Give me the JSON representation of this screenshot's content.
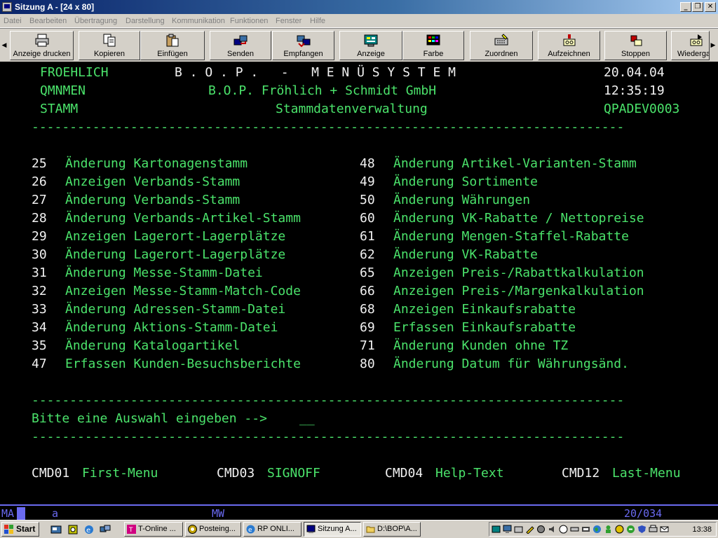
{
  "window": {
    "title": "Sitzung A - [24 x 80]"
  },
  "menubar": {
    "items": [
      "Datei",
      "Bearbeiten",
      "Übertragung",
      "Darstellung",
      "Kommunikation",
      "Funktionen",
      "Fenster",
      "Hilfe"
    ]
  },
  "toolbar": {
    "buttons": [
      {
        "label": "Anzeige drucken",
        "icon": "printer-icon"
      },
      {
        "label": "Kopieren",
        "icon": "copy-icon"
      },
      {
        "label": "Einfügen",
        "icon": "paste-icon"
      },
      {
        "label": "Senden",
        "icon": "send-icon"
      },
      {
        "label": "Empfangen",
        "icon": "receive-icon"
      },
      {
        "label": "Anzeige",
        "icon": "display-icon"
      },
      {
        "label": "Farbe",
        "icon": "color-icon"
      },
      {
        "label": "Zuordnen",
        "icon": "keyboard-icon"
      },
      {
        "label": "Aufzeichnen",
        "icon": "record-icon"
      },
      {
        "label": "Stoppen",
        "icon": "stop-icon"
      },
      {
        "label": "Wiedergabe",
        "icon": "play-icon"
      }
    ]
  },
  "terminal": {
    "header": {
      "user": "FROEHLICH",
      "system_title": "B . O . P .   -   M E N Ü S Y S T E M",
      "date": "20.04.04",
      "program": "QMNMEN",
      "company": "B.O.P. Fröhlich + Schmidt GmbH",
      "time": "12:35:19",
      "menu": "STAMM",
      "menu_title": "Stammdatenverwaltung",
      "device": "QPADEV0003"
    },
    "separator": "------------------------------------------------------------------------------",
    "options_left": [
      {
        "num": "25",
        "text": "Änderung Kartonagenstamm"
      },
      {
        "num": "26",
        "text": "Anzeigen Verbands-Stamm"
      },
      {
        "num": "27",
        "text": "Änderung Verbands-Stamm"
      },
      {
        "num": "28",
        "text": "Änderung Verbands-Artikel-Stamm"
      },
      {
        "num": "29",
        "text": "Anzeigen Lagerort-Lagerplätze"
      },
      {
        "num": "30",
        "text": "Änderung Lagerort-Lagerplätze"
      },
      {
        "num": "31",
        "text": "Änderung Messe-Stamm-Datei"
      },
      {
        "num": "32",
        "text": "Anzeigen Messe-Stamm-Match-Code"
      },
      {
        "num": "33",
        "text": "Änderung Adressen-Stamm-Datei"
      },
      {
        "num": "34",
        "text": "Änderung Aktions-Stamm-Datei"
      },
      {
        "num": "35",
        "text": "Änderung Katalogartikel"
      },
      {
        "num": "47",
        "text": "Erfassen Kunden-Besuchsberichte"
      }
    ],
    "options_right": [
      {
        "num": "48",
        "text": "Änderung Artikel-Varianten-Stamm"
      },
      {
        "num": "49",
        "text": "Änderung Sortimente"
      },
      {
        "num": "50",
        "text": "Änderung Währungen"
      },
      {
        "num": "60",
        "text": "Änderung VK-Rabatte / Nettopreise"
      },
      {
        "num": "61",
        "text": "Änderung Mengen-Staffel-Rabatte"
      },
      {
        "num": "62",
        "text": "Änderung VK-Rabatte"
      },
      {
        "num": "65",
        "text": "Anzeigen Preis-/Rabattkalkulation"
      },
      {
        "num": "66",
        "text": "Anzeigen Preis-/Margenkalkulation"
      },
      {
        "num": "68",
        "text": "Anzeigen Einkaufsrabatte"
      },
      {
        "num": "69",
        "text": "Erfassen Einkaufsrabatte"
      },
      {
        "num": "71",
        "text": "Änderung Kunden ohne TZ"
      },
      {
        "num": "80",
        "text": "Änderung Datum für Währungsänd."
      }
    ],
    "prompt": "Bitte eine Auswahl eingeben -->",
    "input_value": "__",
    "function_keys": [
      {
        "key": "CMD01",
        "label": "First-Menu"
      },
      {
        "key": "CMD03",
        "label": "SIGNOFF"
      },
      {
        "key": "CMD04",
        "label": "Help-Text"
      },
      {
        "key": "CMD12",
        "label": "Last-Menu"
      }
    ]
  },
  "statusline": {
    "mode": "MA",
    "session": "a",
    "indicator": "MW",
    "cursor_pos": "20/034"
  },
  "taskbar": {
    "start_label": "Start",
    "tasks": [
      "T-Online ...",
      "Posteing...",
      "RP ONLI...",
      "Sitzung A...",
      "D:\\BOP\\A..."
    ],
    "clock": "13:38"
  },
  "colors": {
    "terminal_green": "#4be36b",
    "terminal_white": "#f2f2f2",
    "status_blue": "#6a6af0",
    "title_blue": "#0a246a"
  }
}
